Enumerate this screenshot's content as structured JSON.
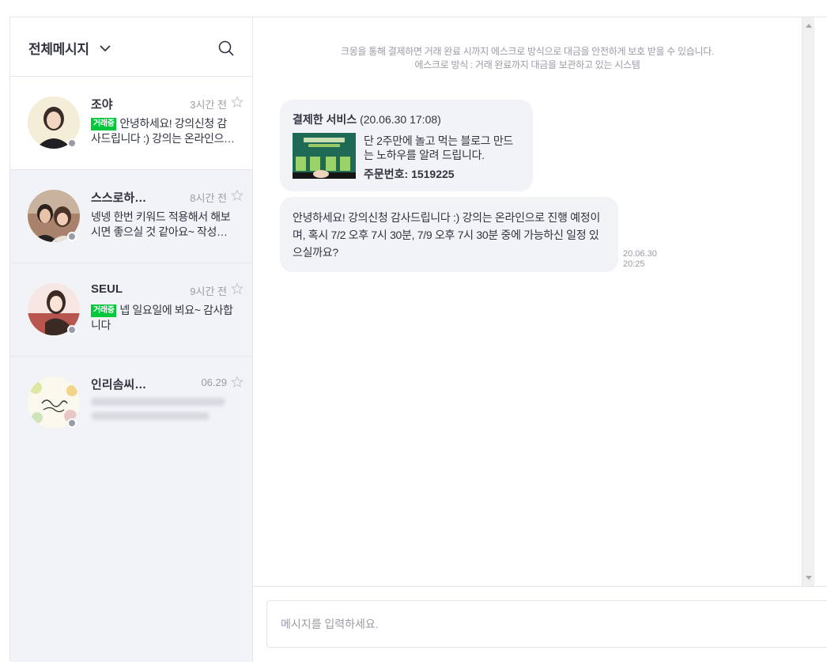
{
  "sidebar": {
    "filter_label": "전체메시지",
    "conversations": [
      {
        "name": "조야",
        "time": "3시간 전",
        "badge": "거래중",
        "preview": "안녕하세요! 강의신청 감사드립니다 :) 강의는 온라인으…"
      },
      {
        "name": "스스로하…",
        "time": "8시간 전",
        "badge": "",
        "preview": "넹넹 한번 키워드 적용해서 해보시면 좋으실 것 같아요~ 작성…"
      },
      {
        "name": "SEUL",
        "time": "9시간 전",
        "badge": "거래중",
        "preview": "넵 일요일에 뵈요~ 감사합니다"
      },
      {
        "name": "인리솜씨…",
        "time": "06.29",
        "badge": "",
        "preview": ""
      }
    ]
  },
  "chat": {
    "notice_line1": "크몽을 통해 결제하면 거래 완료 시까지 에스크로 방식으로 대금을 안전하게 보호 받을 수 있습니다.",
    "notice_line2": "에스크로 방식 : 거래 완료까지 대금을 보관하고 있는 시스템",
    "service_card": {
      "title": "결제한 서비스",
      "datetime": "(20.06.30 17:08)",
      "description": "단 2주만에 놀고 먹는 블로그 만드는 노하우를 알려 드립니다.",
      "order_number": "주문번호: 1519225"
    },
    "message": {
      "text": "안녕하세요! 강의신청 감사드립니다 :) 강의는 온라인으로 진행 예정이며, 혹시 7/2 오후 7시 30분, 7/9 오후 7시 30분 중에 가능하신 일정 있으실까요?",
      "date": "20.06.30",
      "time": "20:25"
    }
  },
  "input": {
    "placeholder": "메시지를 입력하세요."
  },
  "colors": {
    "accent_green": "#00c73c",
    "sidebar_bg": "#f2f3f7",
    "bubble_bg": "#f2f3f7",
    "muted_text": "#9a9ba7"
  }
}
